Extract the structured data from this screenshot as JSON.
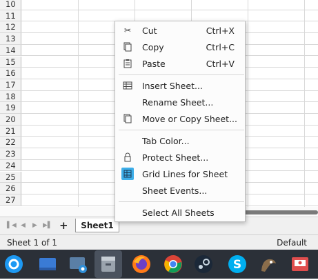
{
  "grid": {
    "row_numbers": [
      "10",
      "11",
      "12",
      "13",
      "14",
      "15",
      "16",
      "17",
      "18",
      "19",
      "20",
      "21",
      "22",
      "23",
      "24",
      "25",
      "26",
      "27"
    ]
  },
  "context_menu": {
    "items": [
      {
        "label": "Cut",
        "shortcut": "Ctrl+X",
        "icon": "scissors-icon"
      },
      {
        "label": "Copy",
        "shortcut": "Ctrl+C",
        "icon": "copy-icon"
      },
      {
        "label": "Paste",
        "shortcut": "Ctrl+V",
        "icon": "clipboard-icon"
      },
      {
        "label": "Insert Sheet...",
        "shortcut": "",
        "icon": "insert-sheet-icon"
      },
      {
        "label": "Rename Sheet...",
        "shortcut": "",
        "icon": ""
      },
      {
        "label": "Move or Copy Sheet...",
        "shortcut": "",
        "icon": "move-copy-icon"
      },
      {
        "label": "Tab Color...",
        "shortcut": "",
        "icon": ""
      },
      {
        "label": "Protect Sheet...",
        "shortcut": "",
        "icon": "lock-icon"
      },
      {
        "label": "Grid Lines for Sheet",
        "shortcut": "",
        "icon": "grid-lines-icon",
        "checked": true
      },
      {
        "label": "Sheet Events...",
        "shortcut": "",
        "icon": ""
      },
      {
        "label": "Select All Sheets",
        "shortcut": "",
        "icon": ""
      }
    ]
  },
  "tabbar": {
    "add_label": "+",
    "active_sheet": "Sheet1"
  },
  "statusbar": {
    "sheet_position": "Sheet 1 of 1",
    "page_style": "Default"
  },
  "taskbar": {
    "apps": [
      "launcher-icon",
      "desktop-icon",
      "screenshot-icon",
      "file-manager-icon",
      "firefox-icon",
      "chrome-icon",
      "steam-icon",
      "skype-icon",
      "gimp-icon",
      "presentation-icon"
    ]
  },
  "colors": {
    "accent": "#3daee9",
    "taskbar_bg": "#2b3038"
  }
}
